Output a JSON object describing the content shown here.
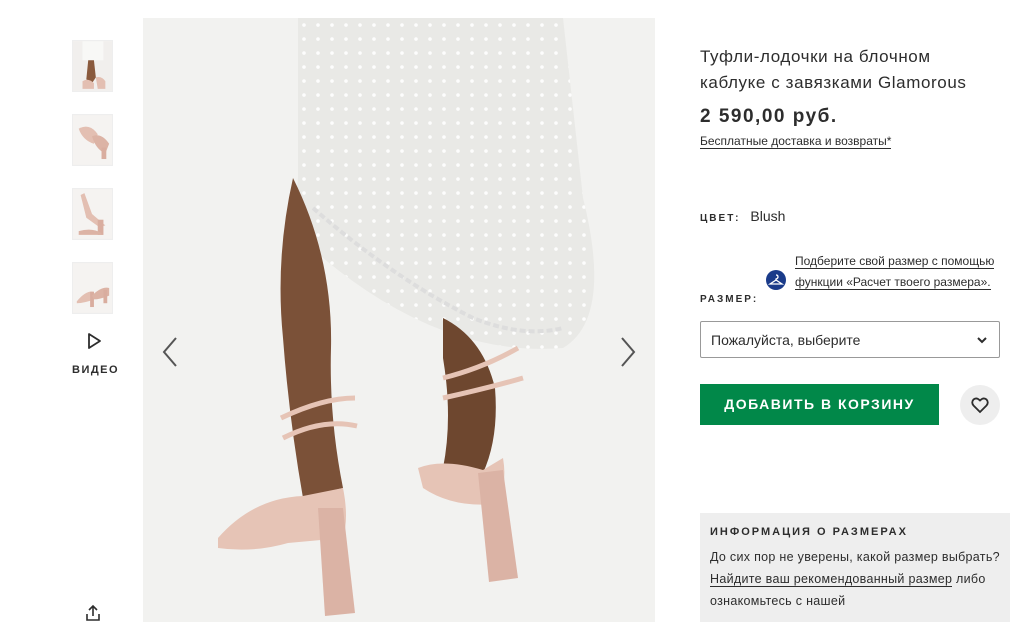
{
  "gallery": {
    "thumbnails": [
      {
        "label": "product-view-1"
      },
      {
        "label": "product-view-2"
      },
      {
        "label": "product-view-3"
      },
      {
        "label": "product-view-4"
      }
    ],
    "video_label": "ВИДЕО",
    "prev_icon": "chevron-left-icon",
    "next_icon": "chevron-right-icon"
  },
  "product": {
    "title": "Туфли-лодочки на блочном каблуке с завязками Glamorous",
    "price": "2 590,00 руб.",
    "delivery_link": "Бесплатные доставка и возвраты*",
    "color_label": "ЦВЕТ:",
    "color_value": "Blush",
    "size_label": "РАЗМЕР:",
    "fit_text_1": "Подберите свой размер с помощью функции «Расчет твоего размера».",
    "size_select_placeholder": "Пожалуйста, выберите",
    "add_to_bag": "ДОБАВИТЬ В КОРЗИНУ"
  },
  "size_info": {
    "heading": "ИНФОРМАЦИЯ О РАЗМЕРАХ",
    "text_1": "До сих пор не уверены, какой размер выбрать?",
    "link": "Найдите ваш рекомендованный размер",
    "text_2": "либо ознакомьтесь с нашей"
  },
  "colors": {
    "accent_green": "#018849",
    "fit_icon_blue": "#1a3b8a",
    "panel_grey": "#eeeeee"
  }
}
